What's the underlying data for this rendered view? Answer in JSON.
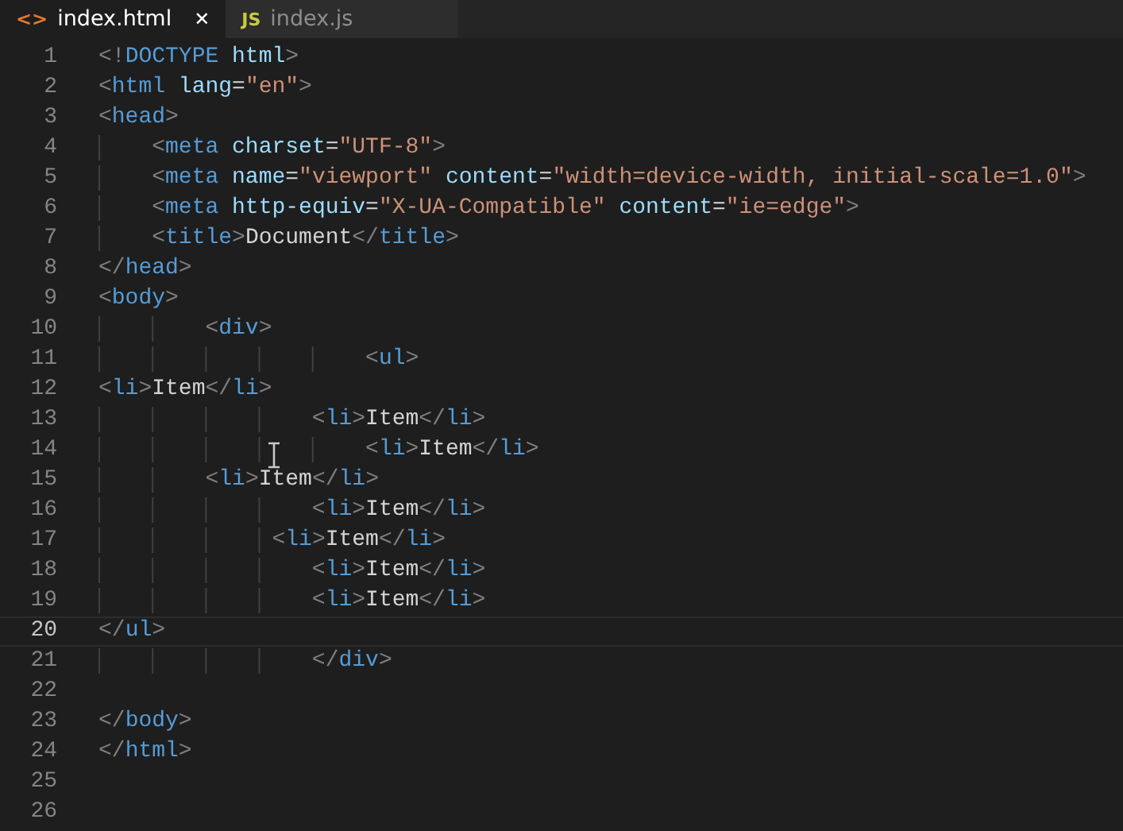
{
  "tabs": [
    {
      "label": "index.html",
      "kind": "html",
      "icon_label": "<>",
      "close_glyph": "✕",
      "selected": true
    },
    {
      "label": "index.js",
      "kind": "js",
      "icon_label": "JS",
      "selected": false
    }
  ],
  "editor": {
    "lines": [
      {
        "number": "1",
        "text": "<!DOCTYPE html>",
        "current": false
      },
      {
        "number": "2",
        "text": "<html lang=\"en\">",
        "current": false
      },
      {
        "number": "3",
        "text": "<head>",
        "current": false
      },
      {
        "number": "4",
        "text": "    <meta charset=\"UTF-8\">",
        "current": false
      },
      {
        "number": "5",
        "text": "    <meta name=\"viewport\" content=\"width=device-width, initial-scale=1.0\">",
        "current": false
      },
      {
        "number": "6",
        "text": "    <meta http-equiv=\"X-UA-Compatible\" content=\"ie=edge\">",
        "current": false
      },
      {
        "number": "7",
        "text": "    <title>Document</title>",
        "current": false
      },
      {
        "number": "8",
        "text": "</head>",
        "current": false
      },
      {
        "number": "9",
        "text": "<body>",
        "current": false
      },
      {
        "number": "10",
        "text": "        <div>",
        "current": false
      },
      {
        "number": "11",
        "text": "                    <ul>",
        "current": false
      },
      {
        "number": "12",
        "text": "<li>Item</li>",
        "current": false
      },
      {
        "number": "13",
        "text": "                <li>Item</li>",
        "current": false
      },
      {
        "number": "14",
        "text": "                    <li>Item</li>",
        "current": false
      },
      {
        "number": "15",
        "text": "        <li>Item</li>",
        "current": false
      },
      {
        "number": "16",
        "text": "                <li>Item</li>",
        "current": false
      },
      {
        "number": "17",
        "text": "             <li>Item</li>",
        "current": false
      },
      {
        "number": "18",
        "text": "                <li>Item</li>",
        "current": false
      },
      {
        "number": "19",
        "text": "                <li>Item</li>",
        "current": false
      },
      {
        "number": "20",
        "text": "</ul>",
        "current": true
      },
      {
        "number": "21",
        "text": "                </div>",
        "current": false
      },
      {
        "number": "22",
        "current": false
      },
      {
        "number": "23",
        "text": "</body>",
        "current": false
      },
      {
        "number": "24",
        "text": "</html>",
        "current": false
      },
      {
        "number": "25",
        "current": false
      },
      {
        "number": "26",
        "current": false
      }
    ]
  }
}
